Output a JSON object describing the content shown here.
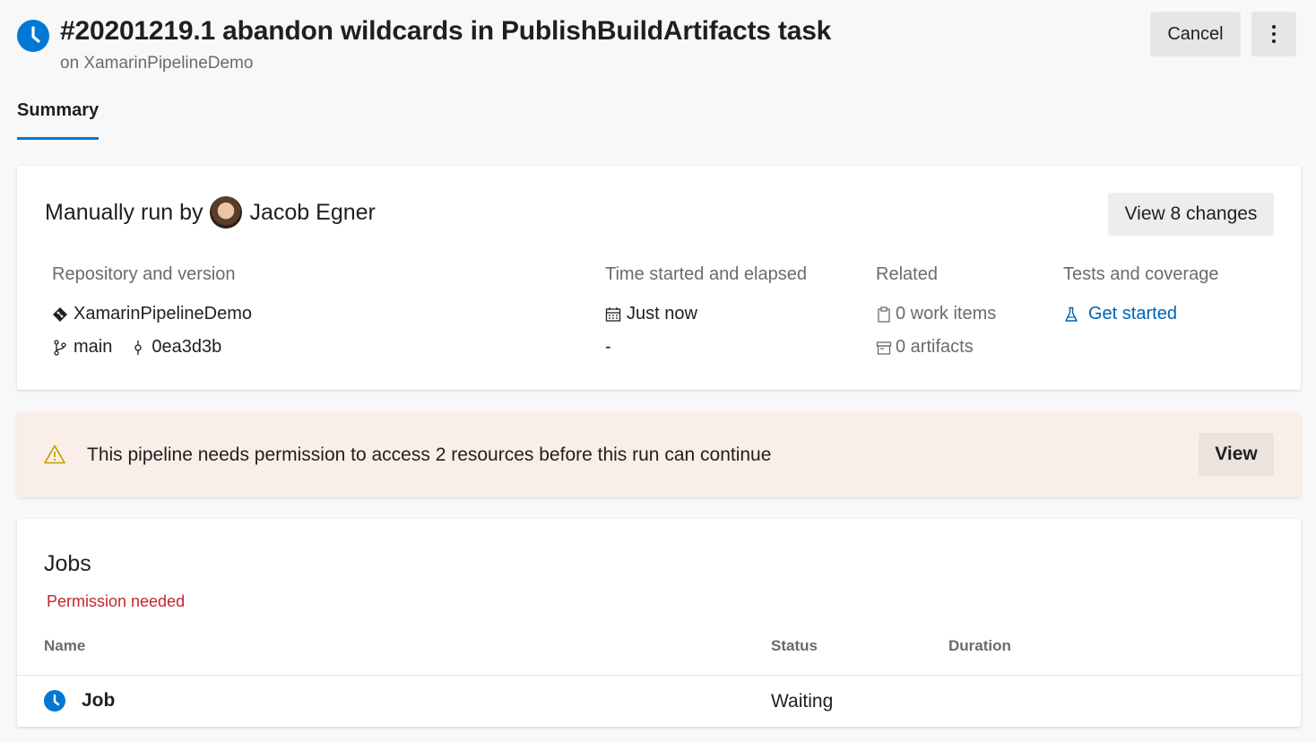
{
  "header": {
    "title": "#20201219.1 abandon wildcards in PublishBuildArtifacts task",
    "subtitle": "on XamarinPipelineDemo",
    "cancel_label": "Cancel",
    "status_icon": "clock-icon",
    "more_icon": "more-vertical-icon"
  },
  "tabs": [
    {
      "label": "Summary",
      "selected": true
    }
  ],
  "summary": {
    "run_by_prefix": "Manually run by",
    "user_name": "Jacob Egner",
    "changes_button": "View 8 changes",
    "repository": {
      "heading": "Repository and version",
      "repo_name": "XamarinPipelineDemo",
      "branch": "main",
      "commit": "0ea3d3b"
    },
    "time": {
      "heading": "Time started and elapsed",
      "started": "Just now",
      "elapsed": "-"
    },
    "related": {
      "heading": "Related",
      "work_items": "0 work items",
      "artifacts": "0 artifacts"
    },
    "tests": {
      "heading": "Tests and coverage",
      "link": "Get started"
    }
  },
  "banner": {
    "message": "This pipeline needs permission to access 2 resources before this run can continue",
    "button": "View",
    "icon": "warning-icon"
  },
  "jobs": {
    "title": "Jobs",
    "group_label": "Permission needed",
    "columns": [
      "Name",
      "Status",
      "Duration"
    ],
    "rows": [
      {
        "name": "Job",
        "status": "Waiting",
        "duration": ""
      }
    ]
  },
  "colors": {
    "accent": "#0078d4",
    "link": "#0063b1",
    "error": "#c4262e",
    "warning_bg": "#f9efe8",
    "warning_icon": "#c19c00"
  }
}
